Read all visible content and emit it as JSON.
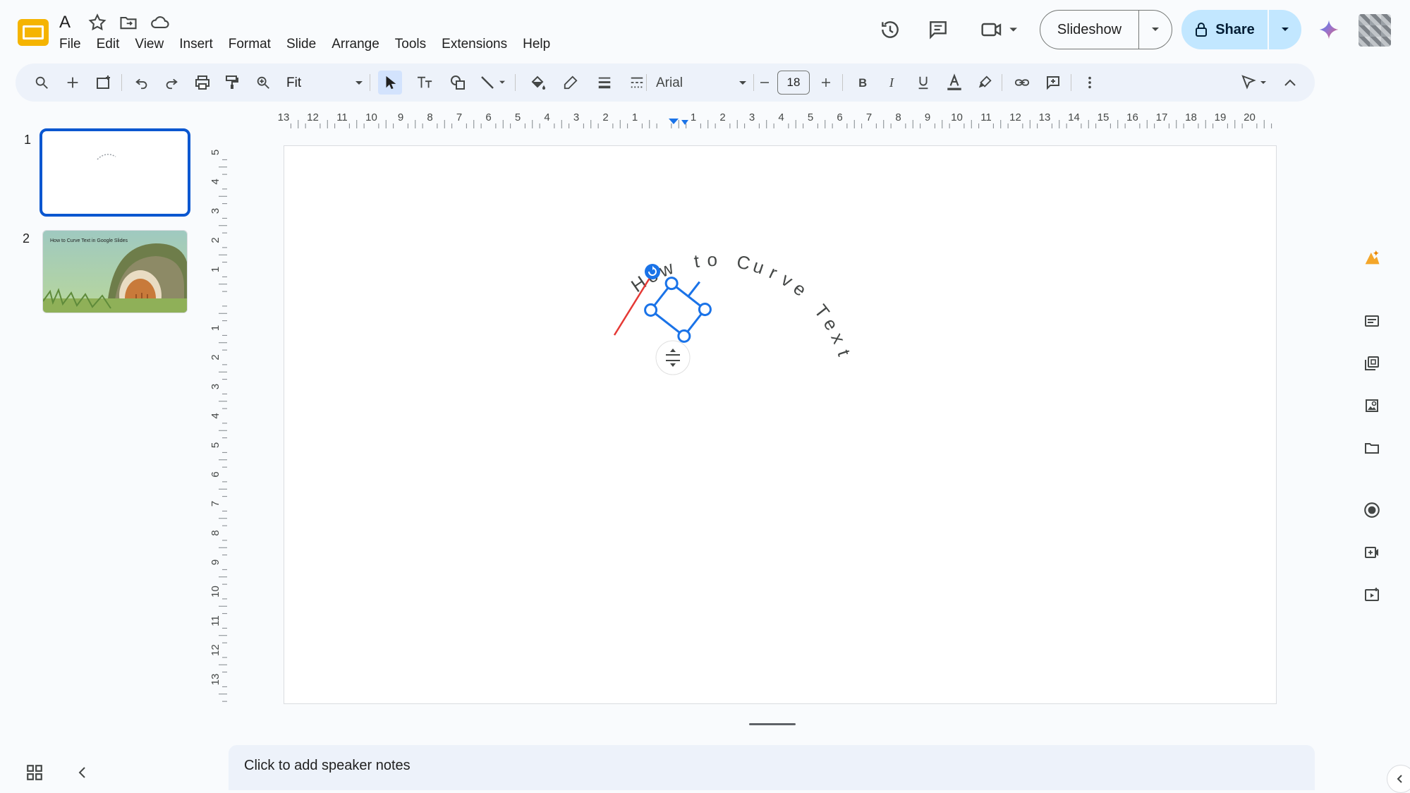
{
  "app": {
    "doc_title": "A",
    "menu": [
      "File",
      "Edit",
      "View",
      "Insert",
      "Format",
      "Slide",
      "Arrange",
      "Tools",
      "Extensions",
      "Help"
    ]
  },
  "header": {
    "slideshow_label": "Slideshow",
    "share_label": "Share"
  },
  "toolbar": {
    "zoom_value": "Fit",
    "font_name": "Arial",
    "font_size": "18"
  },
  "rulers": {
    "horizontal_ticks": [
      "13",
      "12",
      "11",
      "10",
      "9",
      "8",
      "7",
      "6",
      "5",
      "4",
      "3",
      "2",
      "1",
      "",
      "1",
      "2",
      "3",
      "4",
      "5",
      "6",
      "7",
      "8",
      "9",
      "10",
      "11",
      "12",
      "13",
      "14",
      "15",
      "16",
      "17",
      "18",
      "19",
      "20"
    ],
    "vertical_ticks": [
      "5",
      "4",
      "3",
      "2",
      "1",
      "",
      "1",
      "2",
      "3",
      "4",
      "5",
      "6",
      "7",
      "8",
      "9",
      "10",
      "11",
      "12",
      "13"
    ]
  },
  "slides": [
    {
      "number": "1"
    },
    {
      "number": "2",
      "thumbnail_title": "How to Curve Text in Google Slides"
    }
  ],
  "slide_content": {
    "curved_text": [
      "H",
      "o",
      "w",
      " ",
      "t",
      "o",
      " ",
      "C",
      "u",
      "r",
      "v",
      "e",
      " ",
      "T",
      "e",
      "x",
      "t"
    ]
  },
  "notes": {
    "placeholder": "Click to add speaker notes"
  },
  "colors": {
    "accent": "#0b57d0",
    "selection": "#1a73e8",
    "share_bg": "#c2e7ff",
    "arrow": "#e53935"
  }
}
